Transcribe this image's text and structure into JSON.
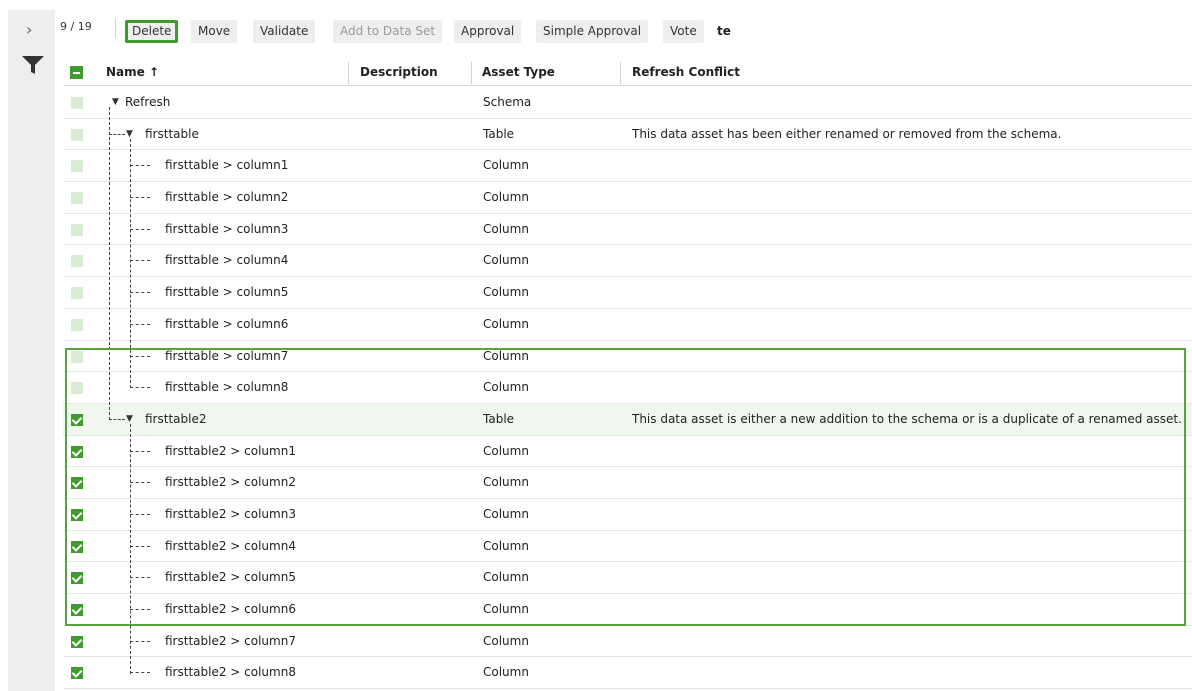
{
  "sidebar": {
    "expand_icon": "chevron-right-icon",
    "filter_icon": "filter-icon"
  },
  "toolbar": {
    "count": "9 / 19",
    "buttons": [
      {
        "label": "Delete",
        "state": "highlighted"
      },
      {
        "label": "Move",
        "state": "enabled"
      },
      {
        "label": "Validate",
        "state": "enabled"
      },
      {
        "label": "Add to Data Set",
        "state": "disabled"
      },
      {
        "label": "Approval",
        "state": "enabled"
      },
      {
        "label": "Simple Approval",
        "state": "enabled"
      },
      {
        "label": "Vote",
        "state": "enabled"
      }
    ],
    "truncated_label": "te"
  },
  "table": {
    "columns": {
      "name": "Name ↑",
      "description": "Description",
      "asset_type": "Asset Type",
      "refresh_conflict": "Refresh Conflict"
    },
    "rows": [
      {
        "name": "Refresh",
        "asset_type": "Schema",
        "conflict": "",
        "checked": false
      },
      {
        "name": "firsttable",
        "asset_type": "Table",
        "conflict": "This data asset has been either renamed or removed from the schema.",
        "checked": false
      },
      {
        "name": "firsttable > column1",
        "asset_type": "Column",
        "conflict": "",
        "checked": false
      },
      {
        "name": "firsttable > column2",
        "asset_type": "Column",
        "conflict": "",
        "checked": false
      },
      {
        "name": "firsttable > column3",
        "asset_type": "Column",
        "conflict": "",
        "checked": false
      },
      {
        "name": "firsttable > column4",
        "asset_type": "Column",
        "conflict": "",
        "checked": false
      },
      {
        "name": "firsttable > column5",
        "asset_type": "Column",
        "conflict": "",
        "checked": false
      },
      {
        "name": "firsttable > column6",
        "asset_type": "Column",
        "conflict": "",
        "checked": false
      },
      {
        "name": "firsttable > column7",
        "asset_type": "Column",
        "conflict": "",
        "checked": false
      },
      {
        "name": "firsttable > column8",
        "asset_type": "Column",
        "conflict": "",
        "checked": false
      },
      {
        "name": "firsttable2",
        "asset_type": "Table",
        "conflict": "This data asset is either a new addition to the schema or is a duplicate of a renamed asset.",
        "checked": true
      },
      {
        "name": "firsttable2 > column1",
        "asset_type": "Column",
        "conflict": "",
        "checked": true
      },
      {
        "name": "firsttable2 > column2",
        "asset_type": "Column",
        "conflict": "",
        "checked": true
      },
      {
        "name": "firsttable2 > column3",
        "asset_type": "Column",
        "conflict": "",
        "checked": true
      },
      {
        "name": "firsttable2 > column4",
        "asset_type": "Column",
        "conflict": "",
        "checked": true
      },
      {
        "name": "firsttable2 > column5",
        "asset_type": "Column",
        "conflict": "",
        "checked": true
      },
      {
        "name": "firsttable2 > column6",
        "asset_type": "Column",
        "conflict": "",
        "checked": true
      },
      {
        "name": "firsttable2 > column7",
        "asset_type": "Column",
        "conflict": "",
        "checked": true
      },
      {
        "name": "firsttable2 > column8",
        "asset_type": "Column",
        "conflict": "",
        "checked": true
      }
    ]
  },
  "colors": {
    "accent_green": "#3f9b2e",
    "highlight_border": "#57a33f",
    "unchecked_box": "#d9ead5"
  }
}
